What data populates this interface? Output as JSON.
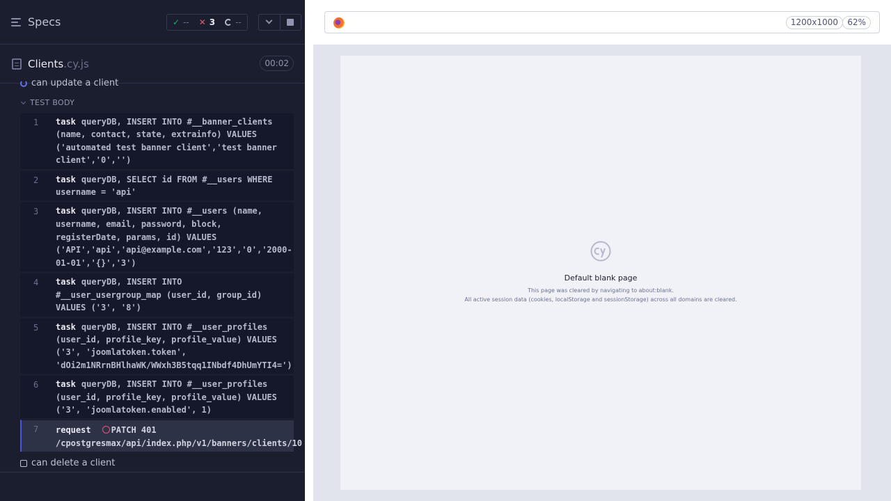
{
  "reporter": {
    "specs_label": "Specs",
    "stats": {
      "passed": "--",
      "failed": "3",
      "pending": "--"
    },
    "file": {
      "name": "Clients",
      "ext": ".cy.js",
      "duration": "00:02"
    },
    "current_test": "can update a client",
    "section": "TEST BODY",
    "commands": [
      {
        "num": "1",
        "name": "task",
        "message": "queryDB, INSERT INTO #__banner_clients (name, contact, state, extrainfo) VALUES ('automated test banner client','test banner client','0','')"
      },
      {
        "num": "2",
        "name": "task",
        "message": "queryDB, SELECT id FROM #__users WHERE username = 'api'"
      },
      {
        "num": "3",
        "name": "task",
        "message": "queryDB, INSERT INTO #__users (name, username, email, password, block, registerDate, params, id) VALUES ('API','api','api@example.com','123','0','2000-01-01','{}','3')"
      },
      {
        "num": "4",
        "name": "task",
        "message": "queryDB, INSERT INTO #__user_usergroup_map (user_id, group_id) VALUES ('3', '8')"
      },
      {
        "num": "5",
        "name": "task",
        "message": "queryDB, INSERT INTO #__user_profiles (user_id, profile_key, profile_value) VALUES ('3', 'joomlatoken.token', 'dOi2m1NRrnBHlhaWK/WWxh3B5tqq1INbdf4DhUmYTI4=')"
      },
      {
        "num": "6",
        "name": "task",
        "message": "queryDB, INSERT INTO #__user_profiles (user_id, profile_key, profile_value) VALUES ('3', 'joomlatoken.enabled', 1)"
      },
      {
        "num": "7",
        "name": "request",
        "message": "PATCH 401 /cpostgresmax/api/index.php/v1/banners/clients/10"
      }
    ],
    "next_test": "can delete a client"
  },
  "aut": {
    "viewport": "1200x1000",
    "zoom": "62%",
    "blank_title": "Default blank page",
    "blank_line1": "This page was cleared by navigating to about:blank.",
    "blank_line2": "All active session data (cookies, localStorage and sessionStorage) across all domains are cleared."
  },
  "colors": {
    "accent": "#4956e3",
    "failed": "#e45770",
    "passed": "#1fa971"
  },
  "icons": [
    "specs-menu-icon",
    "check-icon",
    "x-icon",
    "pending-icon",
    "chevron-down-icon",
    "stop-icon",
    "file-icon",
    "browser-icon",
    "cypress-logo-icon"
  ]
}
